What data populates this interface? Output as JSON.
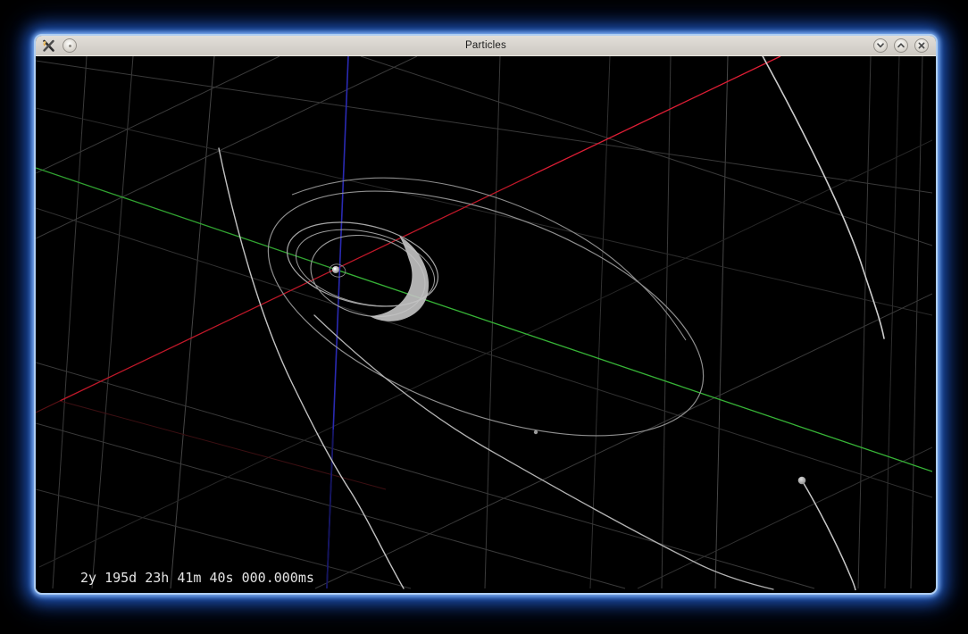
{
  "window": {
    "title": "Particles"
  },
  "titlebar": {
    "app_icon": "crossed-tools-icon",
    "menu_button": "window-menu",
    "shade_glyph": "chevron-down",
    "unshade_glyph": "chevron-up",
    "close_glyph": "cross"
  },
  "viewport": {
    "time_display": "2y 195d 23h 41m 40s 000.000ms",
    "background": "#000000",
    "particles_visible": 3,
    "orbit_rings_visible": 5,
    "axis_colors": {
      "x_axis": "#c11829",
      "y_axis": "#31a331",
      "z_axis": "#2a2ab2"
    },
    "grid_color": "#3a3a3a",
    "orbit_color": "#aaaaaa",
    "trail_color": "#c9c9c9"
  },
  "theme": {
    "frame_glow": "#2e6cd6",
    "titlebar_bg": "#d6d2cb",
    "title_text": "#1c1c1c"
  }
}
